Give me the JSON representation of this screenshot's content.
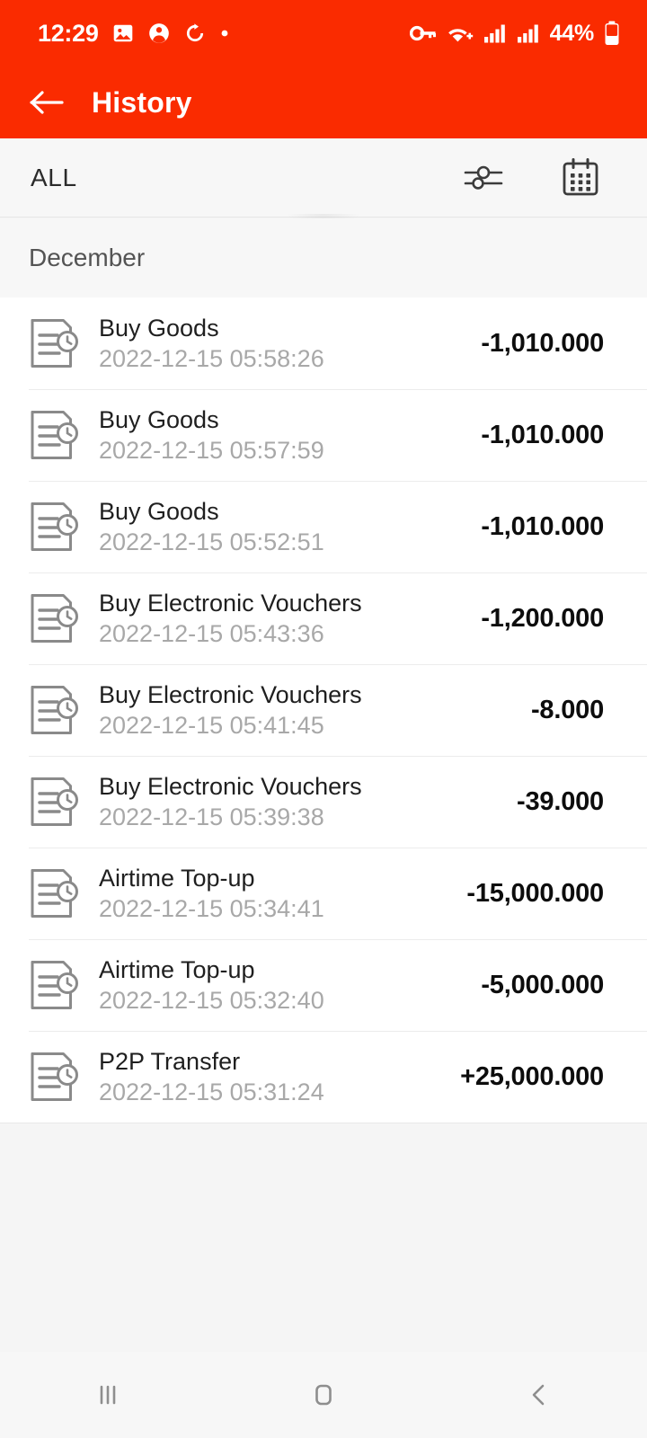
{
  "theme": {
    "brand_red": "#fa2b00",
    "page_bg": "#f5f5f5",
    "bar_bg": "#f7f7f7",
    "amount_color": "#0d0d0d",
    "muted_text": "#a8a8a8"
  },
  "status_bar": {
    "time": "12:29",
    "battery_percent": "44%",
    "left_icons": [
      "image-icon",
      "contact-icon",
      "sync-icon",
      "dot-icon"
    ],
    "right_icons": [
      "vpn-key-icon",
      "wifi-calling-icon",
      "signal-bars-icon",
      "signal-bars-icon",
      "battery-icon"
    ]
  },
  "app_bar": {
    "back_icon": "arrow-left-icon",
    "title": "History"
  },
  "filter_bar": {
    "label": "ALL",
    "filter_icon": "sliders-icon",
    "calendar_icon": "calendar-icon"
  },
  "month_section": {
    "label": "December"
  },
  "transactions": [
    {
      "icon": "document-clock-icon",
      "title": "Buy Goods",
      "time": "2022-12-15 05:58:26",
      "amount": "-1,010.000"
    },
    {
      "icon": "document-clock-icon",
      "title": "Buy Goods",
      "time": "2022-12-15 05:57:59",
      "amount": "-1,010.000"
    },
    {
      "icon": "document-clock-icon",
      "title": "Buy Goods",
      "time": "2022-12-15 05:52:51",
      "amount": "-1,010.000"
    },
    {
      "icon": "document-clock-icon",
      "title": "Buy Electronic Vouchers",
      "time": "2022-12-15 05:43:36",
      "amount": "-1,200.000"
    },
    {
      "icon": "document-clock-icon",
      "title": "Buy Electronic Vouchers",
      "time": "2022-12-15 05:41:45",
      "amount": "-8.000"
    },
    {
      "icon": "document-clock-icon",
      "title": "Buy Electronic Vouchers",
      "time": "2022-12-15 05:39:38",
      "amount": "-39.000"
    },
    {
      "icon": "document-clock-icon",
      "title": "Airtime Top-up",
      "time": "2022-12-15 05:34:41",
      "amount": "-15,000.000"
    },
    {
      "icon": "document-clock-icon",
      "title": "Airtime Top-up",
      "time": "2022-12-15 05:32:40",
      "amount": "-5,000.000"
    },
    {
      "icon": "document-clock-icon",
      "title": "P2P Transfer",
      "time": "2022-12-15 05:31:24",
      "amount": "+25,000.000"
    }
  ],
  "nav_bar": {
    "recents_icon": "recents-icon",
    "home_icon": "home-icon",
    "back_icon": "back-chevron-icon"
  }
}
